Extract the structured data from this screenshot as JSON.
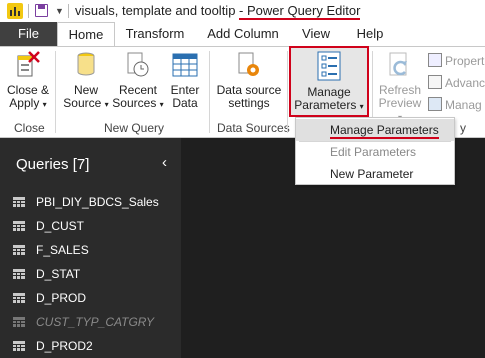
{
  "titlebar": {
    "prefix": "visuals, template and tooltip ",
    "sep": "- ",
    "app_name": "Power Query Editor",
    "colors": {
      "underline": "#d0021b",
      "save": "#7b3fa0",
      "logo": "#f2c811"
    }
  },
  "tabs": [
    "File",
    "Home",
    "Transform",
    "Add Column",
    "View",
    "Help"
  ],
  "ribbon": {
    "close_apply": {
      "line1": "Close &",
      "line2": "Apply"
    },
    "new_source": {
      "line1": "New",
      "line2": "Source"
    },
    "recent_sources": {
      "line1": "Recent",
      "line2": "Sources"
    },
    "enter_data": {
      "line1": "Enter",
      "line2": "Data"
    },
    "data_source_settings": {
      "line1": "Data source",
      "line2": "settings"
    },
    "manage_parameters": {
      "line1": "Manage",
      "line2": "Parameters"
    },
    "refresh_preview": {
      "line1": "Refresh",
      "line2": "Preview"
    },
    "properties": "Properti",
    "advanced": "Advanc",
    "manage": "Manag",
    "groups": {
      "close": "Close",
      "new_query": "New Query",
      "data_sources": "Data Sources",
      "query_partial": "y"
    }
  },
  "manage_menu": {
    "items": [
      "Manage Parameters",
      "Edit Parameters",
      "New Parameter"
    ]
  },
  "queries": {
    "header": "Queries [7]",
    "items": [
      {
        "name": "PBI_DIY_BDCS_Sales",
        "disabled": false
      },
      {
        "name": "D_CUST",
        "disabled": false
      },
      {
        "name": "F_SALES",
        "disabled": false
      },
      {
        "name": "D_STAT",
        "disabled": false
      },
      {
        "name": "D_PROD",
        "disabled": false
      },
      {
        "name": "CUST_TYP_CATGRY",
        "disabled": true
      },
      {
        "name": "D_PROD2",
        "disabled": false
      }
    ]
  }
}
